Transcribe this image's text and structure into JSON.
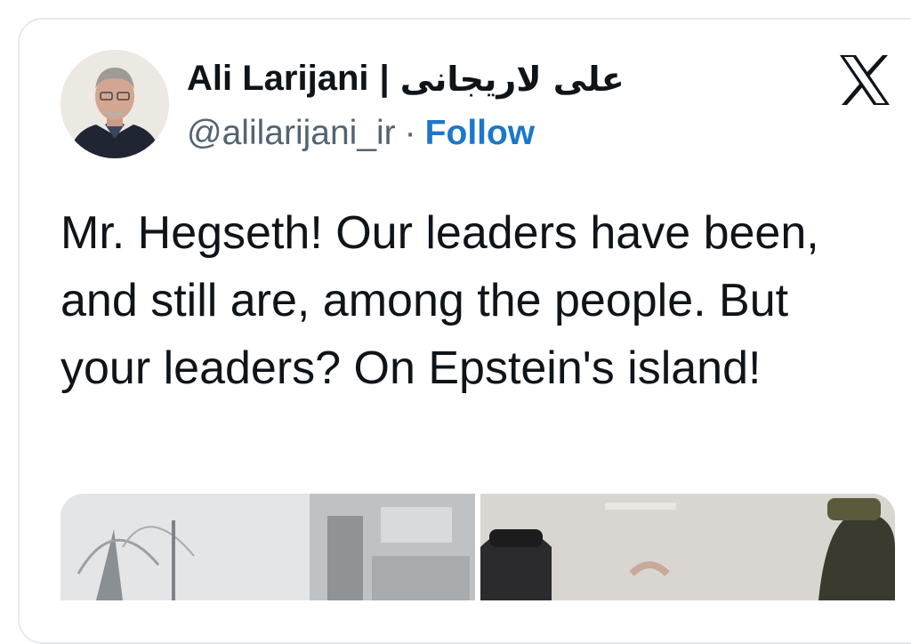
{
  "author": {
    "name": "Ali Larijani",
    "separator": "|",
    "name_fa": "علی لاریجانی",
    "handle": "@alilarijani_ir",
    "dot": "·",
    "follow_label": "Follow"
  },
  "platform_icon": "x-logo-icon",
  "tweet": {
    "text": "Mr. Hegseth! Our leaders have been, and still are, among the people. But your leaders? On Epstein's island!"
  },
  "colors": {
    "follow": "#1d77c9",
    "text": "#0f1419",
    "muted": "#536471"
  }
}
